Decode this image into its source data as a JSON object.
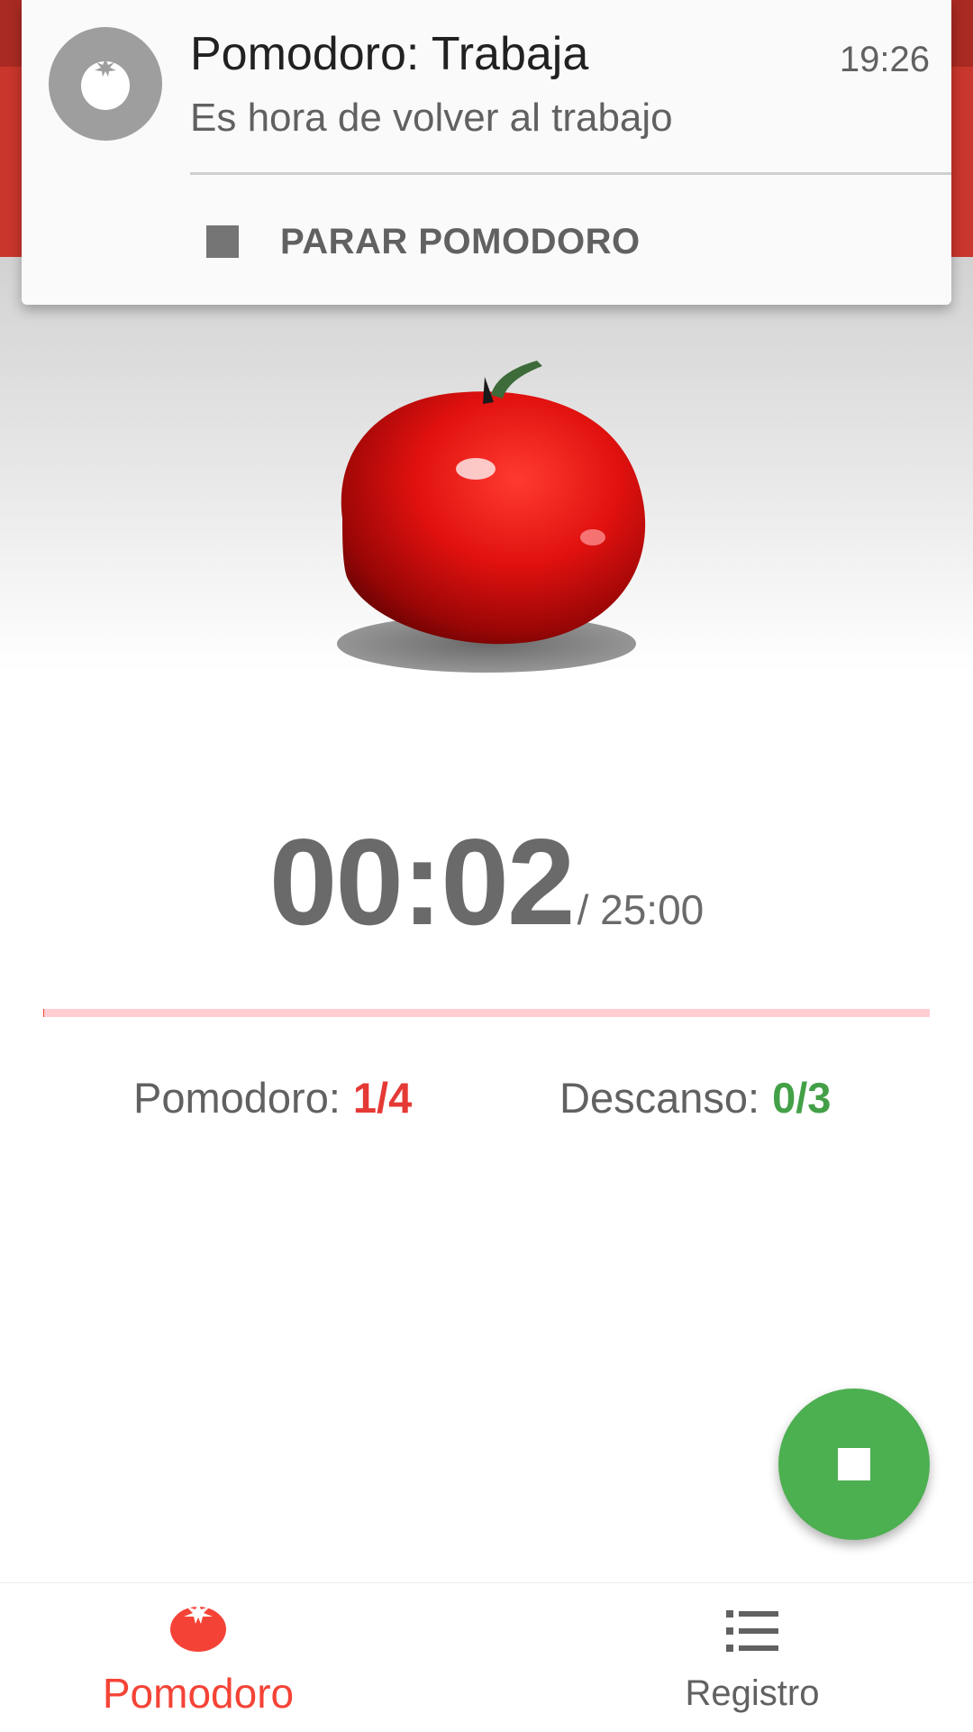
{
  "notification": {
    "title": "Pomodoro: Trabaja",
    "time": "19:26",
    "text": "Es hora de volver al trabajo",
    "action_label": "PARAR POMODORO"
  },
  "timer": {
    "elapsed": "00:02",
    "total": "/ 25:00",
    "progress_fraction": 0.0013
  },
  "stats": {
    "pomodoro_label": "Pomodoro:",
    "pomodoro_value": "1/4",
    "descanso_label": "Descanso:",
    "descanso_value": "0/3"
  },
  "fab": {
    "icon": "stop-icon"
  },
  "bottom_nav": {
    "items": [
      {
        "label": "Pomodoro",
        "icon": "tomato-icon",
        "active": true
      },
      {
        "label": "Registro",
        "icon": "list-icon",
        "active": false
      }
    ]
  },
  "colors": {
    "primary": "#c9362c",
    "accent_red": "#f44336",
    "accent_green": "#4caf50"
  }
}
